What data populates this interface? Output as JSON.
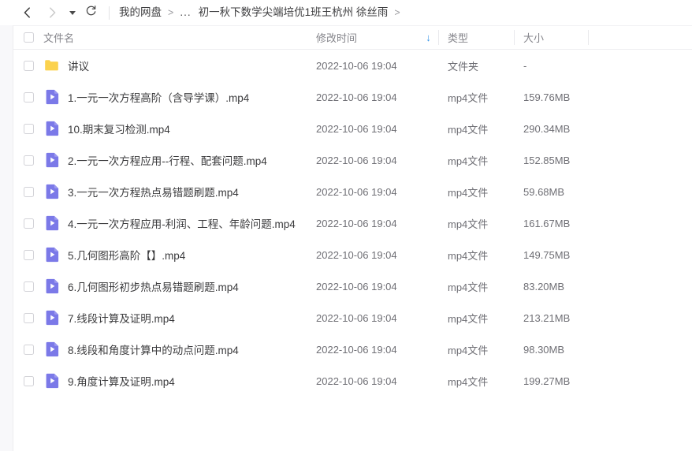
{
  "window": {
    "background": "#ffffff",
    "gutter_color": "#f8f8fa"
  },
  "toolbar": {
    "back_icon": "chevron-left-icon",
    "back_enabled": true,
    "forward_icon": "chevron-right-icon",
    "forward_enabled": false,
    "history_caret_icon": "caret-down-icon",
    "refresh_icon": "refresh-icon"
  },
  "breadcrumb": {
    "separator": ">",
    "ellipsis": "...",
    "trailing_separator": ">",
    "items": [
      {
        "label": "我的网盘"
      },
      {
        "label": "初一秋下数学尖端培优1班王杭州 徐丝雨"
      }
    ]
  },
  "table": {
    "select_all_checked": false,
    "sort": {
      "column": "修改时间",
      "direction": "desc",
      "arrow": "↓"
    },
    "columns": [
      {
        "key": "name",
        "label": "文件名"
      },
      {
        "key": "date",
        "label": "修改时间"
      },
      {
        "key": "type",
        "label": "类型"
      },
      {
        "key": "size",
        "label": "大小"
      }
    ],
    "rows": [
      {
        "icon": "folder-icon",
        "name": "讲议",
        "date": "2022-10-06 19:04",
        "type": "文件夹",
        "size": "-",
        "checked": false
      },
      {
        "icon": "video-file-icon",
        "name": "1.一元一次方程高阶（含导学课）.mp4",
        "date": "2022-10-06 19:04",
        "type": "mp4文件",
        "size": "159.76MB",
        "checked": false
      },
      {
        "icon": "video-file-icon",
        "name": "10.期末复习检测.mp4",
        "date": "2022-10-06 19:04",
        "type": "mp4文件",
        "size": "290.34MB",
        "checked": false
      },
      {
        "icon": "video-file-icon",
        "name": "2.一元一次方程应用--行程、配套问题.mp4",
        "date": "2022-10-06 19:04",
        "type": "mp4文件",
        "size": "152.85MB",
        "checked": false
      },
      {
        "icon": "video-file-icon",
        "name": "3.一元一次方程热点易错题刷题.mp4",
        "date": "2022-10-06 19:04",
        "type": "mp4文件",
        "size": "59.68MB",
        "checked": false
      },
      {
        "icon": "video-file-icon",
        "name": "4.一元一次方程应用-利润、工程、年龄问题.mp4",
        "date": "2022-10-06 19:04",
        "type": "mp4文件",
        "size": "161.67MB",
        "checked": false
      },
      {
        "icon": "video-file-icon",
        "name": "5.几何图形高阶【】.mp4",
        "date": "2022-10-06 19:04",
        "type": "mp4文件",
        "size": "149.75MB",
        "checked": false
      },
      {
        "icon": "video-file-icon",
        "name": "6.几何图形初步热点易错题刷题.mp4",
        "date": "2022-10-06 19:04",
        "type": "mp4文件",
        "size": "83.20MB",
        "checked": false
      },
      {
        "icon": "video-file-icon",
        "name": "7.线段计算及证明.mp4",
        "date": "2022-10-06 19:04",
        "type": "mp4文件",
        "size": "213.21MB",
        "checked": false
      },
      {
        "icon": "video-file-icon",
        "name": "8.线段和角度计算中的动点问题.mp4",
        "date": "2022-10-06 19:04",
        "type": "mp4文件",
        "size": "98.30MB",
        "checked": false
      },
      {
        "icon": "video-file-icon",
        "name": "9.角度计算及证明.mp4",
        "date": "2022-10-06 19:04",
        "type": "mp4文件",
        "size": "199.27MB",
        "checked": false
      }
    ]
  },
  "colors": {
    "folder": "#fbd24e",
    "video_file": "#7b79e8",
    "sort_arrow": "#3a96e8",
    "text_primary": "#3b3b3d",
    "text_secondary": "#6f6f75",
    "header_text": "#85858b",
    "border": "#ededf0"
  }
}
